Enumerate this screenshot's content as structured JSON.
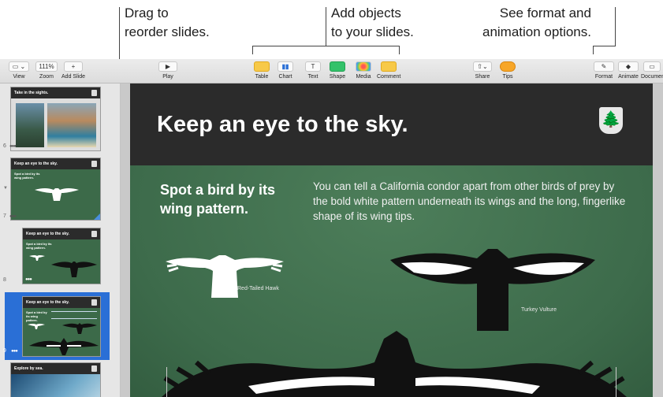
{
  "callouts": {
    "drag": "Drag to\nreorder slides.",
    "add": "Add objects\nto your slides.",
    "format": "See format and\nanimation options."
  },
  "toolbar": {
    "view": {
      "label": "View",
      "button": "▭ ⌄"
    },
    "zoom": {
      "label": "Zoom",
      "value": "111%"
    },
    "add_slide": {
      "label": "Add Slide",
      "button": "+"
    },
    "play": {
      "label": "Play"
    },
    "table": {
      "label": "Table"
    },
    "chart": {
      "label": "Chart"
    },
    "text": {
      "label": "Text",
      "button": "T"
    },
    "shape": {
      "label": "Shape"
    },
    "media": {
      "label": "Media"
    },
    "comment": {
      "label": "Comment"
    },
    "share": {
      "label": "Share"
    },
    "tips": {
      "label": "Tips"
    },
    "format": {
      "label": "Format"
    },
    "animate": {
      "label": "Animate"
    },
    "document": {
      "label": "Document"
    }
  },
  "colors": {
    "accent": "#2a6fd6",
    "slide_green": "#3d6b4b",
    "header_dark": "#2b2b2b",
    "toolbar_yellow": "#f7c948"
  },
  "sidebar": {
    "slides": [
      {
        "number": "6",
        "title": "Take in the sights."
      },
      {
        "number": "7",
        "title": "Keep an eye to the sky.",
        "subtitle": "Spot a bird by its wing pattern."
      },
      {
        "number": "8",
        "title": "Keep an eye to the sky.",
        "subtitle": "Spot a bird by its wing pattern."
      },
      {
        "number": "9",
        "title": "Keep an eye to the sky.",
        "subtitle": "Spot a bird by its wing pattern."
      },
      {
        "number": "10",
        "title": "Explore by sea."
      }
    ]
  },
  "slide": {
    "title": "Keep an eye to the sky.",
    "subhead": "Spot a bird by its wing pattern.",
    "body": "You can tell a California condor apart from other birds of prey by the bold white pattern underneath its wings and the long, fingerlike shape of its wing tips.",
    "hawk_label": "Red-Tailed Hawk",
    "vulture_label": "Turkey Vulture"
  }
}
